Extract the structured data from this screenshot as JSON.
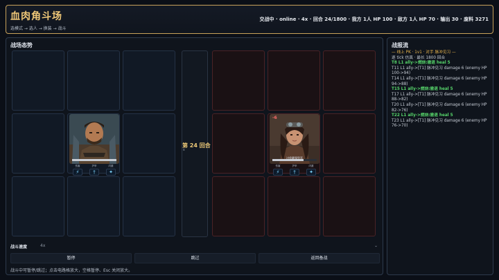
{
  "header": {
    "title": "血肉角斗场",
    "breadcrumb": "选模式 → 选人 → 换装 → 战斗",
    "status": "交战中 · online · 4x · 回合 24/1800 · 我方 1人 HP 100 · 敌方 1人 HP 70 · 输出 30 · 废料 3271"
  },
  "battlefield": {
    "title": "战场态势",
    "round_label": "第 24 回合",
    "round_sub": "s",
    "hit_glyph": "✎",
    "ally": {
      "hp_percent": 100,
      "hp_color": "#c9ced6",
      "stats": [
        {
          "label": "伤害",
          "icon": "lightning-rune-icon",
          "glyph": "⚡"
        },
        {
          "label": "护甲",
          "icon": "sword-rune-icon",
          "glyph": "†"
        },
        {
          "label": "闪避",
          "icon": "spark-rune-icon",
          "glyph": "✦"
        }
      ]
    },
    "enemy": {
      "damage_text": "-6",
      "name": "讨伐最强型巫",
      "hp_percent": 70,
      "hp_color": "#c9ced6",
      "stats": [
        {
          "label": "伤害",
          "icon": "lightning-rune-icon",
          "glyph": "⚡"
        },
        {
          "label": "护甲",
          "icon": "sword-rune-icon",
          "glyph": "†"
        },
        {
          "label": "闪避",
          "icon": "spark-rune-icon",
          "glyph": "✦"
        }
      ]
    },
    "speed": {
      "label": "战斗速度",
      "value": "4x"
    },
    "buttons": {
      "pause": "暂停",
      "skip": "跳过",
      "back": "返回备战"
    },
    "hint": "战斗中可暂停/跳过；点击电路格放大，空格暂停、Esc 关闭放大。"
  },
  "log": {
    "title": "战报流",
    "lines": [
      {
        "text": "— 线上 PK · 1v1 · 对手 脉冲见习 —",
        "style": "gold"
      },
      {
        "text": "逐 tick 仿真 · 最长 1800 回合",
        "style": "normal"
      },
      {
        "text": "T8 L1 ally->燃烧:撤退 heal 5",
        "style": "green"
      },
      {
        "text": "T11 L1 ally->[T1] 脉冲见习 damage 6 (enemy HP 100->94)",
        "style": "normal"
      },
      {
        "text": "T14 L1 ally->[T1] 脉冲见习 damage 6 (enemy HP 94->88)",
        "style": "normal"
      },
      {
        "text": "T15 L1 ally->燃烧:撤退 heal 5",
        "style": "green"
      },
      {
        "text": "T17 L1 ally->[T1] 脉冲见习 damage 6 (enemy HP 88->82)",
        "style": "normal"
      },
      {
        "text": "T20 L1 ally->[T1] 脉冲见习 damage 6 (enemy HP 82->76)",
        "style": "normal"
      },
      {
        "text": "T22 L1 ally->燃烧:撤退 heal 5",
        "style": "green"
      },
      {
        "text": "T23 L1 ally->[T1] 脉冲见习 damage 6 (enemy HP 76->70)",
        "style": "normal"
      }
    ]
  }
}
